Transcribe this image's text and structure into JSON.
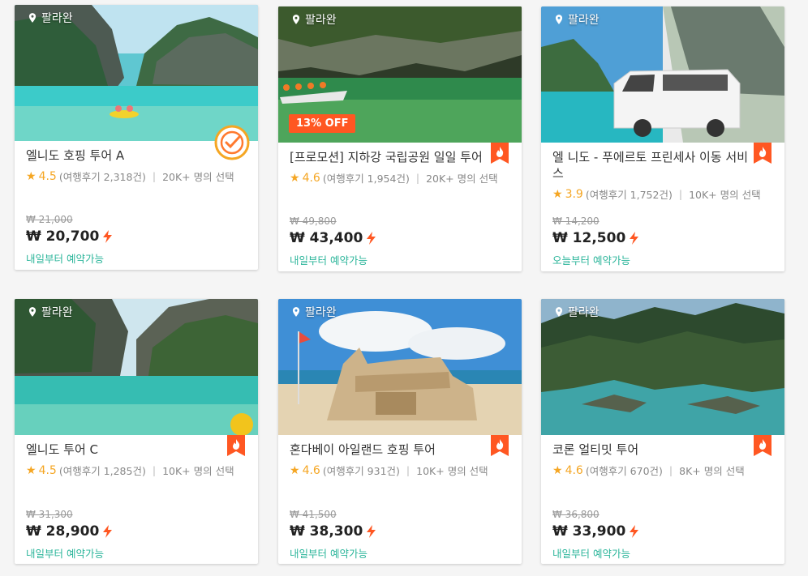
{
  "cards": [
    {
      "location": "팔라완",
      "title": "엘니도 호핑 투어 A",
      "rating": "4.5",
      "reviews": "(여행후기 2,318건)",
      "chosen": "20K+ 명의 선택",
      "old_price": "₩ 21,000",
      "price": "₩ 20,700",
      "availability": "내일부터 예약가능",
      "badge": "award"
    },
    {
      "location": "팔라완",
      "title": "[프로모션] 지하강 국립공원 일일 투어",
      "rating": "4.6",
      "reviews": "(여행후기 1,954건)",
      "chosen": "20K+ 명의 선택",
      "old_price": "₩ 49,800",
      "price": "₩ 43,400",
      "availability": "내일부터 예약가능",
      "badge": "hot",
      "discount": "13% OFF"
    },
    {
      "location": "팔라완",
      "title": "엘 니도 - 푸에르토 프린세사 이동 서비스",
      "rating": "3.9",
      "reviews": "(여행후기 1,752건)",
      "chosen": "10K+ 명의 선택",
      "old_price": "₩ 14,200",
      "price": "₩ 12,500",
      "availability": "오늘부터 예약가능",
      "badge": "hot"
    },
    {
      "location": "팔라완",
      "title": "엘니도 투어 C",
      "rating": "4.5",
      "reviews": "(여행후기 1,285건)",
      "chosen": "10K+ 명의 선택",
      "old_price": "₩ 31,300",
      "price": "₩ 28,900",
      "availability": "내일부터 예약가능",
      "badge": "hot"
    },
    {
      "location": "팔라완",
      "title": "혼다베이 아일랜드 호핑 투어",
      "rating": "4.6",
      "reviews": "(여행후기 931건)",
      "chosen": "10K+ 명의 선택",
      "old_price": "₩ 41,500",
      "price": "₩ 38,300",
      "availability": "내일부터 예약가능",
      "badge": "hot"
    },
    {
      "location": "팔라완",
      "title": "코론 얼티밋 투어",
      "rating": "4.6",
      "reviews": "(여행후기 670건)",
      "chosen": "8K+ 명의 선택",
      "old_price": "₩ 36,800",
      "price": "₩ 33,900",
      "availability": "내일부터 예약가능",
      "badge": "hot"
    }
  ],
  "colors": {
    "accent": "#ff5722",
    "star": "#f5a623",
    "availability": "#2bb59a"
  }
}
